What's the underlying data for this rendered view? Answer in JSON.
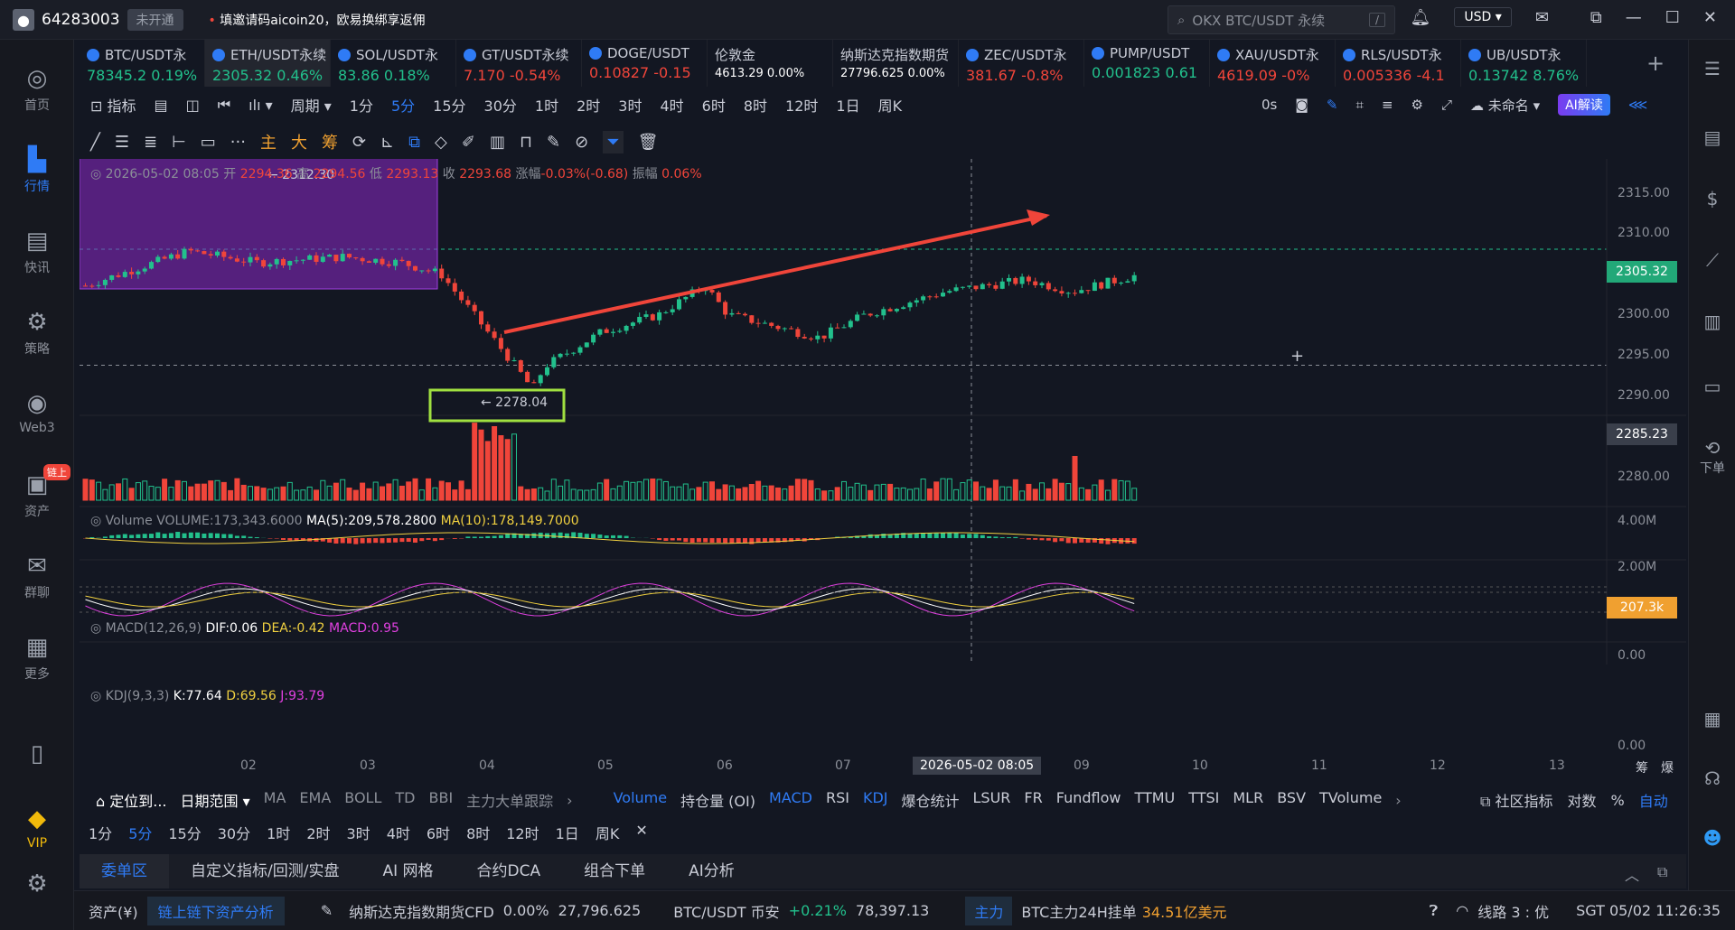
{
  "header": {
    "uid": "64283003",
    "badge": "未开通",
    "promo": "填邀请码aicoin20，欧易换绑享返佣",
    "search_placeholder": "OKX BTC/USDT 永续",
    "search_key": "/",
    "currency": "USD"
  },
  "sidebar": [
    {
      "label": "首页",
      "icon": "home-icon"
    },
    {
      "label": "行情",
      "icon": "market-icon"
    },
    {
      "label": "快讯",
      "icon": "news-icon"
    },
    {
      "label": "策略",
      "icon": "strategy-icon"
    },
    {
      "label": "Web3",
      "icon": "web3-icon"
    },
    {
      "label": "资产",
      "icon": "wallet-icon",
      "badge": "链上"
    },
    {
      "label": "群聊",
      "icon": "chat-icon"
    },
    {
      "label": "更多",
      "icon": "grid-icon"
    },
    {
      "label": "VIP",
      "icon": "vip-icon"
    }
  ],
  "tickers": [
    {
      "name": "BTC/USDT永",
      "price": "78345.2",
      "change": "0.19%",
      "dir": "up"
    },
    {
      "name": "ETH/USDT永续",
      "price": "2305.32",
      "change": "0.46%",
      "dir": "up"
    },
    {
      "name": "SOL/USDT永",
      "price": "83.86",
      "change": "0.18%",
      "dir": "up"
    },
    {
      "name": "GT/USDT永续",
      "price": "7.170",
      "change": "-0.54%",
      "dir": "down"
    },
    {
      "name": "DOGE/USDT",
      "price": "0.10827",
      "change": "-0.15",
      "dir": "down"
    },
    {
      "name": "伦敦金",
      "price": "4613.29",
      "change": "0.00%",
      "dir": "flat"
    },
    {
      "name": "纳斯达克指数期货",
      "price": "27796.625",
      "change": "0.00%",
      "dir": "flat"
    },
    {
      "name": "ZEC/USDT永",
      "price": "381.67",
      "change": "-0.8%",
      "dir": "down"
    },
    {
      "name": "PUMP/USDT",
      "price": "0.001823",
      "change": "0.61",
      "dir": "up"
    },
    {
      "name": "XAU/USDT永",
      "price": "4619.09",
      "change": "-0%",
      "dir": "down"
    },
    {
      "name": "RLS/USDT永",
      "price": "0.005336",
      "change": "-4.1",
      "dir": "down"
    },
    {
      "name": "UB/USDT永",
      "price": "0.13742",
      "change": "8.76%",
      "dir": "up"
    }
  ],
  "toolbar": {
    "indicator": "指标",
    "period": "周期",
    "intervals": [
      "1分",
      "5分",
      "15分",
      "30分",
      "1时",
      "2时",
      "3时",
      "4时",
      "6时",
      "8时",
      "12时",
      "1日",
      "周K"
    ],
    "selected_interval": "5分",
    "countdown": "0s",
    "layout": "未命名",
    "ai": "AI解读"
  },
  "drawtools": {
    "main": "主",
    "big": "大",
    "chip": "筹"
  },
  "ohlc": {
    "time": "2026-05-02 08:05",
    "open_label": "开",
    "open": "2294.36",
    "high_label": "高",
    "high": "2294.56",
    "low_label": "低",
    "low": "2293.13",
    "close_label": "收",
    "close": "2293.68",
    "chg_label": "涨幅",
    "chg": "-0.03%(-0.68)",
    "amp_label": "振幅",
    "amp": "0.06%"
  },
  "price_axis": [
    "2315.00",
    "2310.00",
    "2305.32",
    "2300.00",
    "2295.00",
    "2290.00",
    "2285.23",
    "2280.00"
  ],
  "annotations": {
    "high": "2312.30",
    "low": "2278.04"
  },
  "volume": {
    "label": "Volume",
    "vol": "VOLUME:173,343.6000",
    "ma5": "MA(5):209,578.2800",
    "ma10": "MA(10):178,149.7000",
    "axis": [
      "4.00M",
      "2.00M",
      "207.3k"
    ]
  },
  "macd": {
    "label": "MACD(12,26,9)",
    "dif": "DIF:0.06",
    "dea": "DEA:-0.42",
    "macd": "MACD:0.95",
    "zero": "0.00"
  },
  "kdj": {
    "label": "KDJ(9,3,3)",
    "k": "K:77.64",
    "d": "D:69.56",
    "j": "J:93.79",
    "zero": "0.00"
  },
  "x_axis": [
    "02",
    "03",
    "04",
    "05",
    "06",
    "07",
    "2026-05-02 08:05",
    "09",
    "10",
    "11",
    "12",
    "13"
  ],
  "x_right": [
    "筹",
    "爆"
  ],
  "bottom1": {
    "locate": "定位到...",
    "range": "日期范围",
    "items": [
      "MA",
      "EMA",
      "BOLL",
      "TD",
      "BBI",
      "主力大单跟踪"
    ],
    "sub": [
      "Volume",
      "持仓量 (OI)",
      "MACD",
      "RSI",
      "KDJ",
      "爆仓统计",
      "LSUR",
      "FR",
      "Fundflow",
      "TTMU",
      "TTSI",
      "MLR",
      "BSV",
      "TVolume"
    ],
    "community": "社区指标",
    "log": "对数",
    "pct": "%",
    "auto": "自动"
  },
  "bottom2": [
    "1分",
    "5分",
    "15分",
    "30分",
    "1时",
    "2时",
    "3时",
    "4时",
    "6时",
    "8时",
    "12时",
    "1日",
    "周K"
  ],
  "tabs": [
    "委单区",
    "自定义指标/回测/实盘",
    "AI 网格",
    "合约DCA",
    "组合下单",
    "AI分析"
  ],
  "status": {
    "assets": "资产(¥)",
    "chain": "链上链下资产分析",
    "nasdaq": "纳斯达克指数期货CFD",
    "nasdaq_chg": "0.00%",
    "nasdaq_price": "27,796.625",
    "btc": "BTC/USDT 币安",
    "btc_chg": "+0.21%",
    "btc_price": "78,397.13",
    "main": "主力",
    "main_text": "BTC主力24H挂单",
    "main_val": "34.51亿美元",
    "line": "线路 3 : 优",
    "time": "SGT 05/02 11:26:35"
  },
  "right_sidebar": {
    "order": "下单"
  }
}
